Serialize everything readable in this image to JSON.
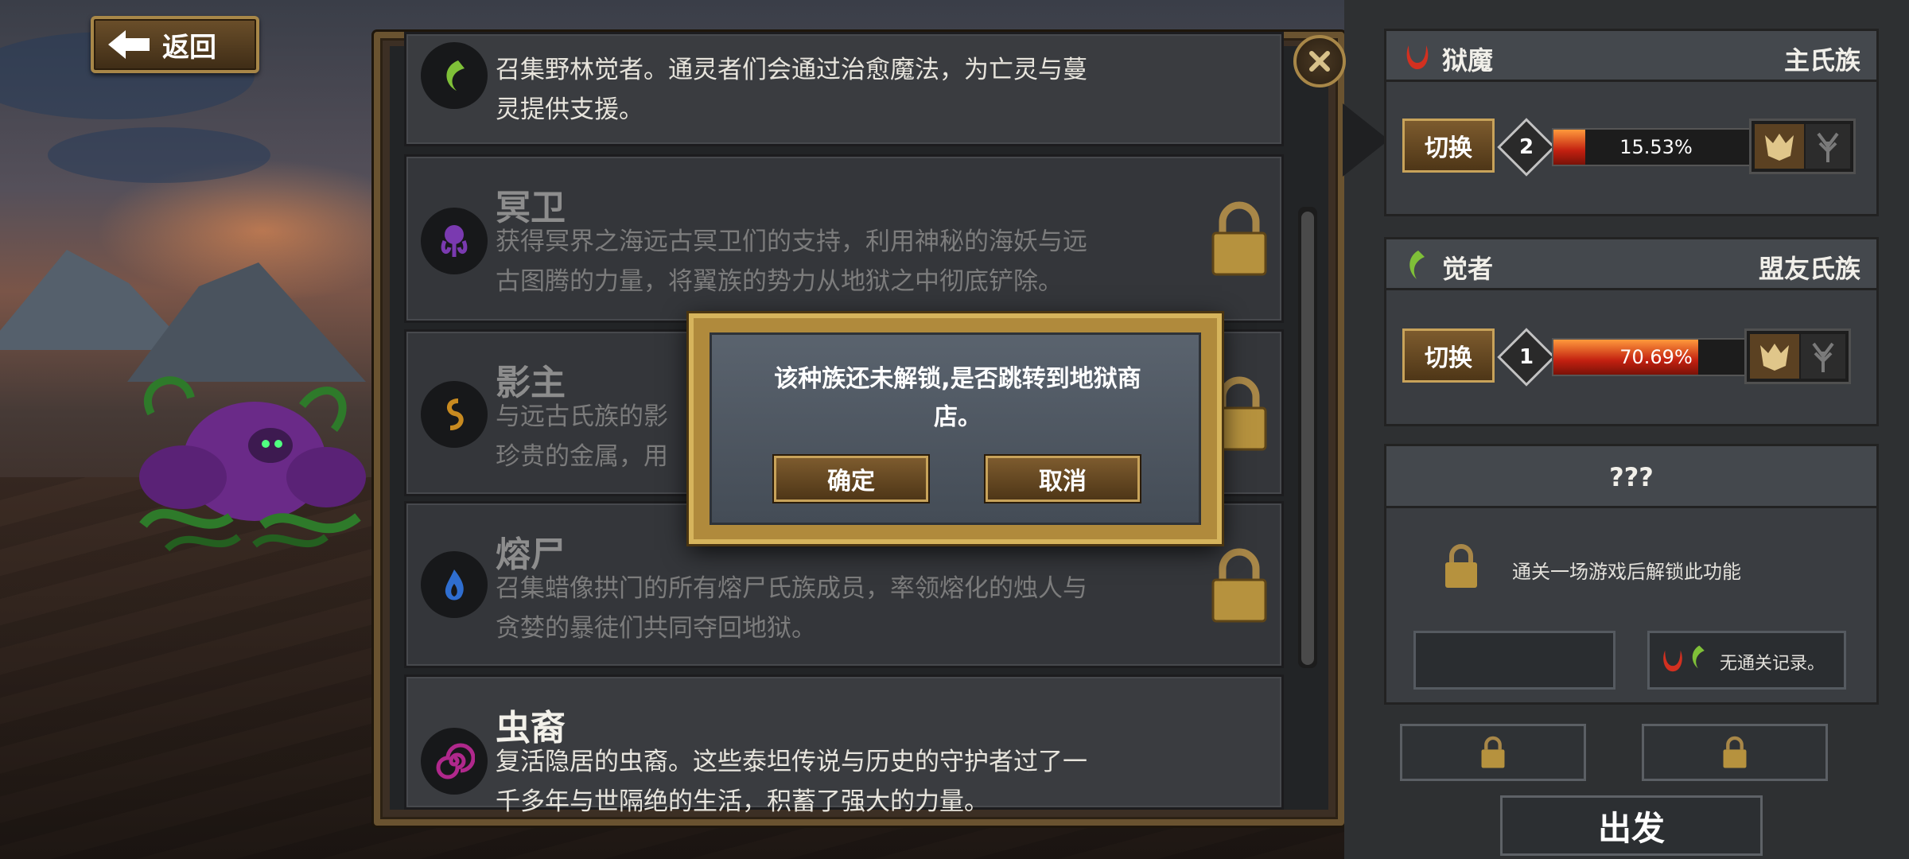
{
  "nav": {
    "back_label": "返回"
  },
  "clans": [
    {
      "name": "",
      "desc_line1": "召集野林觉者。通灵者们会通过治愈魔法，为亡灵与蔓",
      "desc_line2": "灵提供支援。",
      "icon": "vine-icon",
      "locked": false
    },
    {
      "name": "冥卫",
      "desc_line1": "获得冥界之海远古冥卫们的支持，利用神秘的海妖与远",
      "desc_line2": "古图腾的力量，将翼族的势力从地狱之中彻底铲除。",
      "icon": "octopus-icon",
      "locked": true
    },
    {
      "name": "影主",
      "desc_line1": "与远古氏族的影",
      "desc_line2": "珍贵的金属，用",
      "icon": "serpent-icon",
      "locked": true
    },
    {
      "name": "熔尸",
      "desc_line1": "召集蜡像拱门的所有熔尸氏族成员，率领熔化的烛人与",
      "desc_line2": "贪婪的暴徒们共同夺回地狱。",
      "icon": "flame-icon",
      "locked": true
    },
    {
      "name": "虫裔",
      "desc_line1": "复活隐居的虫裔。这些泰坦传说与历史的守护者过了一",
      "desc_line2": "千多年与世隔绝的生活，积蓄了强大的力量。",
      "icon": "spiral-icon",
      "locked": false
    }
  ],
  "dialog": {
    "message_line1": "该种族还未解锁,是否跳转到地狱商",
    "message_line2": "店。",
    "confirm_label": "确定",
    "cancel_label": "取消"
  },
  "sidebar": {
    "main_clan": {
      "name": "狱魔",
      "role": "主氏族",
      "switch_label": "切换",
      "level": "2",
      "progress_text": "15.53%",
      "progress": 0.1553
    },
    "ally_clan": {
      "name": "觉者",
      "role": "盟友氏族",
      "switch_label": "切换",
      "level": "1",
      "progress_text": "70.69%",
      "progress": 0.7069
    },
    "third": {
      "title": "???",
      "unlock_text": "通关一场游戏后解锁此功能",
      "record_text": "无通关记录。"
    },
    "go_label": "出发"
  },
  "colors": {
    "accent_gold": "#c8a35a",
    "bar_red": "#c22010",
    "active_purple": "#b0288c"
  }
}
